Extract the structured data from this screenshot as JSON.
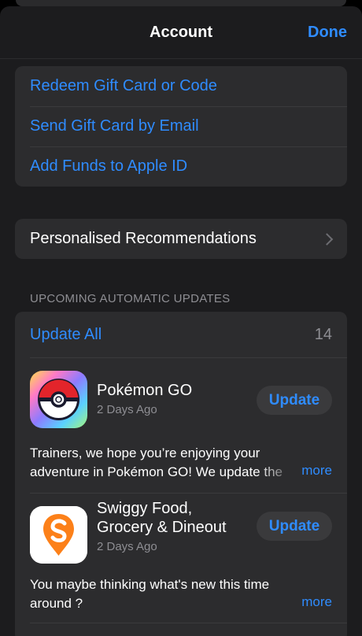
{
  "nav": {
    "title": "Account",
    "done_label": "Done"
  },
  "gift_group": {
    "items": [
      {
        "label": "Redeem Gift Card or Code"
      },
      {
        "label": "Send Gift Card by Email"
      },
      {
        "label": "Add Funds to Apple ID"
      }
    ]
  },
  "personalised": {
    "label": "Personalised Recommendations"
  },
  "updates": {
    "section_header": "UPCOMING AUTOMATIC UPDATES",
    "update_all_label": "Update All",
    "count": "14",
    "apps": [
      {
        "name": "Pokémon GO",
        "date": "2 Days Ago",
        "button": "Update",
        "desc_line1": "Trainers, we hope you’re enjoying your",
        "desc_line2": "adventure in Pokémon GO! We update the",
        "more": "more",
        "icon": "pokeball-icon"
      },
      {
        "name_line1": "Swiggy Food,",
        "name_line2": "Grocery & Dineout",
        "date": "2 Days Ago",
        "button": "Update",
        "desc_line1": "You maybe thinking what's new this time",
        "desc_line2": "around ?",
        "more": "more",
        "icon": "swiggy-logo-icon"
      }
    ]
  },
  "colors": {
    "accent": "#2f8cff",
    "background": "#1c1c1e",
    "cell": "#2c2c2e",
    "secondary_text": "#8e8e93",
    "swiggy_orange": "#fc8019"
  }
}
